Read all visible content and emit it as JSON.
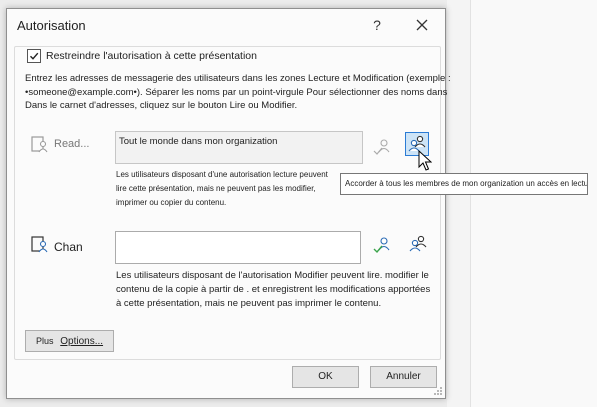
{
  "dialog": {
    "title": "Autorisation",
    "help_label": "?"
  },
  "restrict": {
    "checked": true,
    "label": "Restreindre l'autorisation à cette présentation"
  },
  "instructions": {
    "line1": "Entrez les adresses de messagerie des utilisateurs dans les zones Lecture et Modification (exemple :",
    "line2": "•someone@example.com•). Séparer les noms par un point-virgule Pour sélectionner des noms dans",
    "line3": "Dans le carnet d'adresses, cliquez sur le bouton Lire ou Modifier."
  },
  "read": {
    "label": "Read...",
    "value": "Tout le monde dans mon organization",
    "desc1": "Les utilisateurs disposant d'une autorisation lecture peuvent",
    "desc2": "lire cette présentation, mais ne peuvent pas les modifier,",
    "desc3": "imprimer ou copier du contenu."
  },
  "change": {
    "label": "Chan",
    "value": "",
    "desc1": "Les utilisateurs disposant de l'autorisation Modifier peuvent lire. modifier le",
    "desc2": "contenu de la copie à partir de . et enregistrent les modifications apportées",
    "desc3": "à cette présentation, mais ne peuvent pas imprimer le contenu."
  },
  "tooltip": "Accorder à tous les membres de mon organization un accès en lecture",
  "buttons": {
    "more_prefix": "Plus",
    "more_options": "Options...",
    "ok": "OK",
    "cancel": "Annuler"
  },
  "icons": {
    "close": "close-icon",
    "read": "read-permission-icon",
    "change": "change-permission-icon",
    "address_book": "address-book-check-icon",
    "everyone": "everyone-icon"
  },
  "colors": {
    "accent": "#2b7bd4",
    "selected_bg": "#cde4f7",
    "icon_green": "#3aa34a"
  }
}
